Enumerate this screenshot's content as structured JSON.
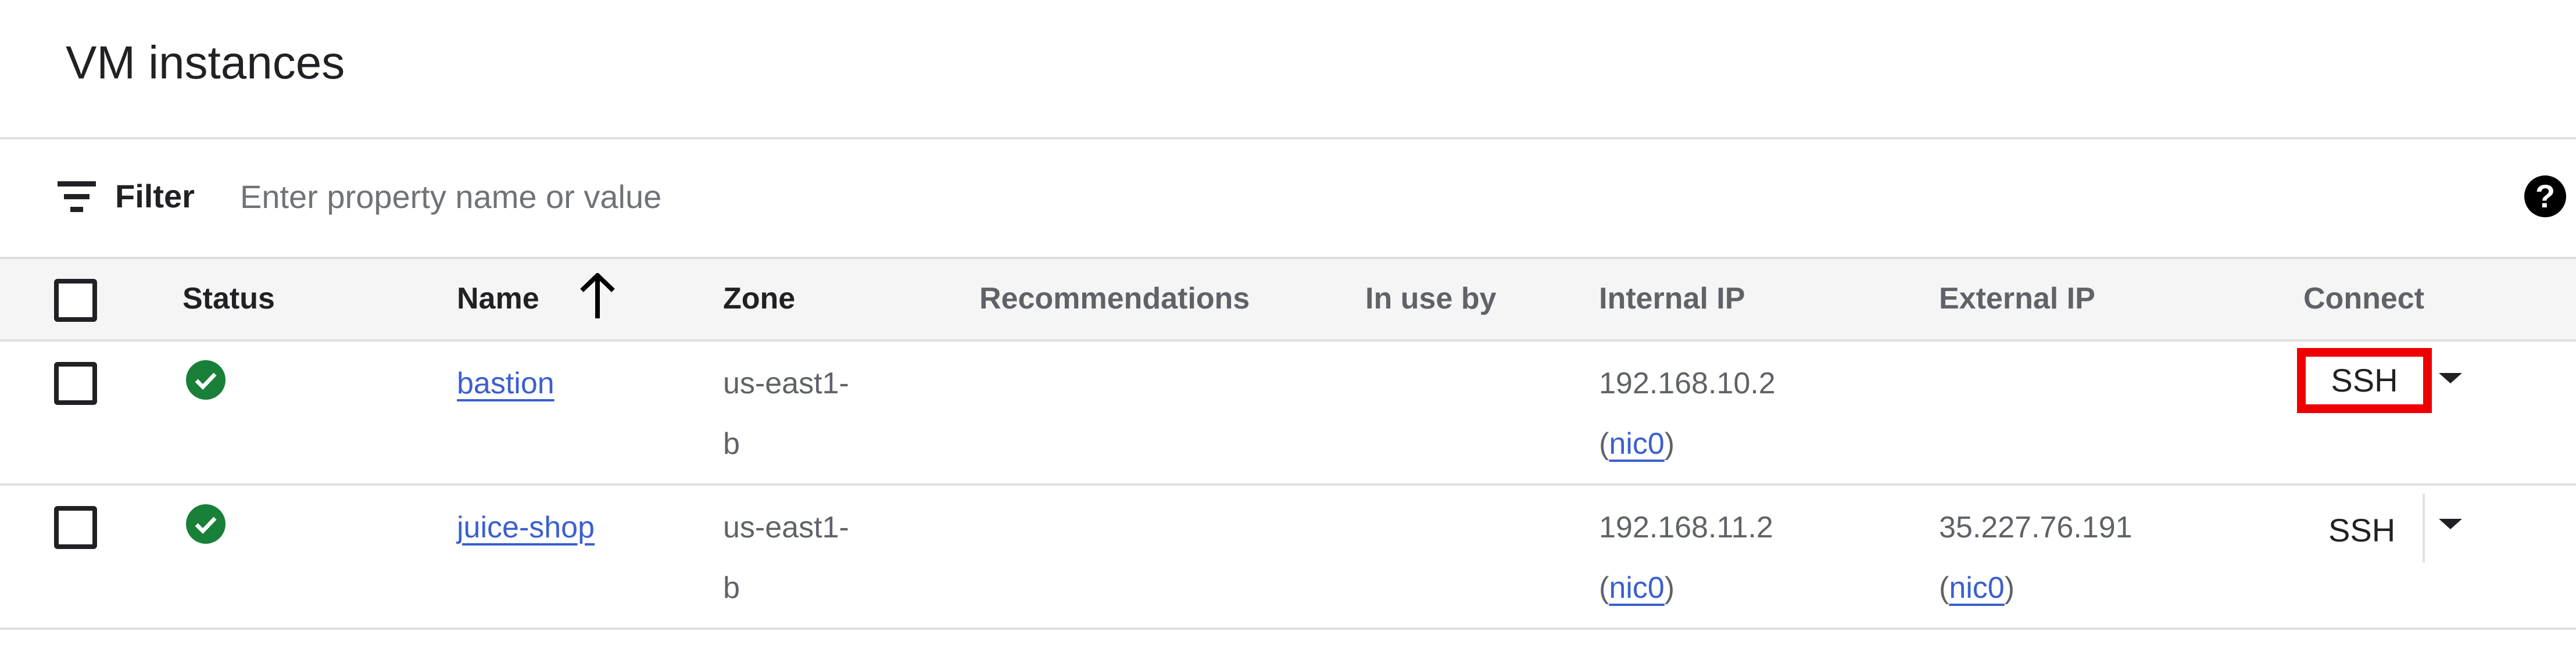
{
  "page": {
    "title": "VM instances"
  },
  "filter": {
    "label": "Filter",
    "placeholder": "Enter property name or value",
    "value": "",
    "icon": "filter-list-icon",
    "help_icon": "help-circle-icon",
    "help_glyph": "?"
  },
  "table": {
    "columns": [
      "Status",
      "Name",
      "Zone",
      "Recommendations",
      "In use by",
      "Internal IP",
      "External IP",
      "Connect"
    ],
    "sort": {
      "column": "Name",
      "direction": "ascending",
      "icon": "arrow-up-icon"
    },
    "rows": [
      {
        "status": "running",
        "name": "bastion",
        "zone_line1": "us-east1-",
        "zone_line2": "b",
        "internal_ip": "192.168.10.2",
        "internal_nic": "nic0",
        "external_ip": "",
        "external_nic": "",
        "connect": "SSH",
        "focused": true
      },
      {
        "status": "running",
        "name": "juice-shop",
        "zone_line1": "us-east1-",
        "zone_line2": "b",
        "internal_ip": "192.168.11.2",
        "internal_nic": "nic0",
        "external_ip": "35.227.76.191",
        "external_nic": "nic0",
        "connect": "SSH",
        "focused": false
      }
    ]
  },
  "colors": {
    "link": "#3b5fcf",
    "status_ok": "#188038",
    "highlight": "#ee0000",
    "header_bg": "#f5f5f5"
  }
}
